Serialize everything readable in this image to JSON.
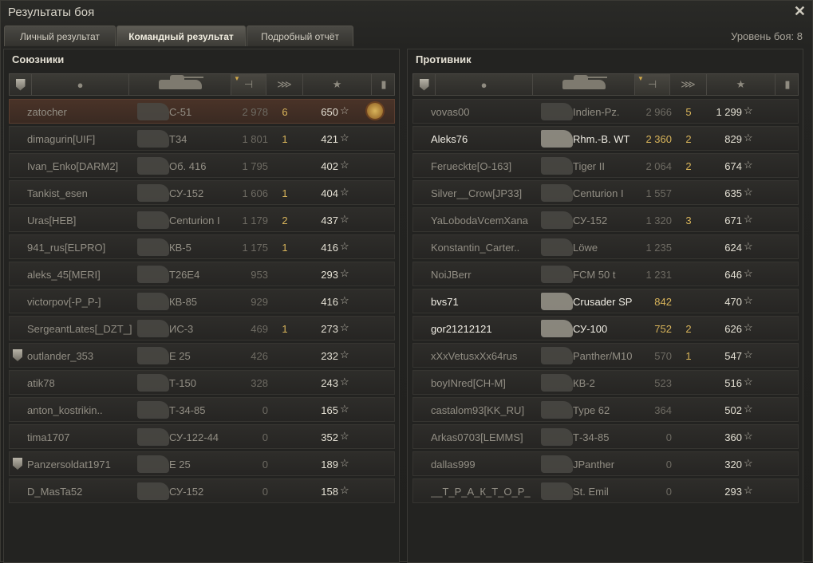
{
  "window": {
    "title": "Результаты боя",
    "close_icon": "✕"
  },
  "tabs": [
    {
      "label": "Личный результат",
      "active": false
    },
    {
      "label": "Командный результат",
      "active": true
    },
    {
      "label": "Подробный отчёт",
      "active": false
    }
  ],
  "battle_level": "Уровень боя: 8",
  "allies": {
    "title": "Союзники",
    "rows": [
      {
        "player": "zatocher",
        "tank": "С-51",
        "xp": "2 978",
        "kills": "6",
        "score": "650",
        "medal": true,
        "me": true
      },
      {
        "player": "dimagurin[UIF]",
        "tank": "Т34",
        "xp": "1 801",
        "kills": "1",
        "score": "421"
      },
      {
        "player": "Ivan_Enko[DARM2]",
        "tank": "Об. 416",
        "xp": "1 795",
        "kills": "",
        "score": "402"
      },
      {
        "player": "Tankist_esen",
        "tank": "СУ-152",
        "xp": "1 606",
        "kills": "1",
        "score": "404"
      },
      {
        "player": "Uras[HEB]",
        "tank": "Centurion I",
        "xp": "1 179",
        "kills": "2",
        "score": "437"
      },
      {
        "player": "941_rus[ELPRO]",
        "tank": "КВ-5",
        "xp": "1 175",
        "kills": "1",
        "score": "416"
      },
      {
        "player": "aleks_45[MERI]",
        "tank": "T26E4",
        "xp": "953",
        "kills": "",
        "score": "293"
      },
      {
        "player": "victorpov[-P_P-]",
        "tank": "КВ-85",
        "xp": "929",
        "kills": "",
        "score": "416"
      },
      {
        "player": "SergeantLates[_DZT_]",
        "tank": "ИС-3",
        "xp": "469",
        "kills": "1",
        "score": "273"
      },
      {
        "player": "outlander_353",
        "tank": "E 25",
        "xp": "426",
        "kills": "",
        "score": "232",
        "badge": true
      },
      {
        "player": "atik78",
        "tank": "Т-150",
        "xp": "328",
        "kills": "",
        "score": "243"
      },
      {
        "player": "anton_kostrikin..",
        "tank": "Т-34-85",
        "xp": "0",
        "kills": "",
        "score": "165"
      },
      {
        "player": "tima1707",
        "tank": "СУ-122-44",
        "xp": "0",
        "kills": "",
        "score": "352"
      },
      {
        "player": "Panzersoldat1971",
        "tank": "E 25",
        "xp": "0",
        "kills": "",
        "score": "189",
        "badge": true
      },
      {
        "player": "D_MasTa52",
        "tank": "СУ-152",
        "xp": "0",
        "kills": "",
        "score": "158"
      }
    ]
  },
  "enemies": {
    "title": "Противник",
    "rows": [
      {
        "player": "vovas00",
        "tank": "Indien-Pz.",
        "xp": "2 966",
        "kills": "5",
        "score": "1 299"
      },
      {
        "player": "Aleks76",
        "tank": "Rhm.-B. WT",
        "xp": "2 360",
        "kills": "2",
        "score": "829",
        "alive": true
      },
      {
        "player": "Ferueckte[O-163]",
        "tank": "Tiger II",
        "xp": "2 064",
        "kills": "2",
        "score": "674"
      },
      {
        "player": "Silver__Crow[JP33]",
        "tank": "Centurion I",
        "xp": "1 557",
        "kills": "",
        "score": "635"
      },
      {
        "player": "YaLobodaVcemXana",
        "tank": "СУ-152",
        "xp": "1 320",
        "kills": "3",
        "score": "671"
      },
      {
        "player": "Konstantin_Carter..",
        "tank": "Löwe",
        "xp": "1 235",
        "kills": "",
        "score": "624"
      },
      {
        "player": "NoiJBerr",
        "tank": "FCM 50 t",
        "xp": "1 231",
        "kills": "",
        "score": "646"
      },
      {
        "player": "bvs71",
        "tank": "Crusader SP",
        "xp": "842",
        "kills": "",
        "score": "470",
        "alive": true
      },
      {
        "player": "gor21212121",
        "tank": "СУ-100",
        "xp": "752",
        "kills": "2",
        "score": "626",
        "alive": true
      },
      {
        "player": "xXxVetusxXx64rus",
        "tank": "Panther/M10",
        "xp": "570",
        "kills": "1",
        "score": "547"
      },
      {
        "player": "boyINred[CH-M]",
        "tank": "КВ-2",
        "xp": "523",
        "kills": "",
        "score": "516"
      },
      {
        "player": "castalom93[KK_RU]",
        "tank": "Type 62",
        "xp": "364",
        "kills": "",
        "score": "502"
      },
      {
        "player": "Arkas0703[LEMMS]",
        "tank": "Т-34-85",
        "xp": "0",
        "kills": "",
        "score": "360"
      },
      {
        "player": "dallas999",
        "tank": "JPanther",
        "xp": "0",
        "kills": "",
        "score": "320"
      },
      {
        "player": "__Т_Р_А_К_Т_О_Р_",
        "tank": "St. Emil",
        "xp": "0",
        "kills": "",
        "score": "293"
      }
    ]
  },
  "columns": [
    "squad-icon",
    "player-icon",
    "tank-icon",
    "xp-icon",
    "kills-icon",
    "star-icon",
    "medal-icon"
  ],
  "star_glyph": "☆",
  "colors": {
    "xp_alive": "#d8b45a",
    "kills": "#d8b45a",
    "self_row": "#4a3328"
  }
}
